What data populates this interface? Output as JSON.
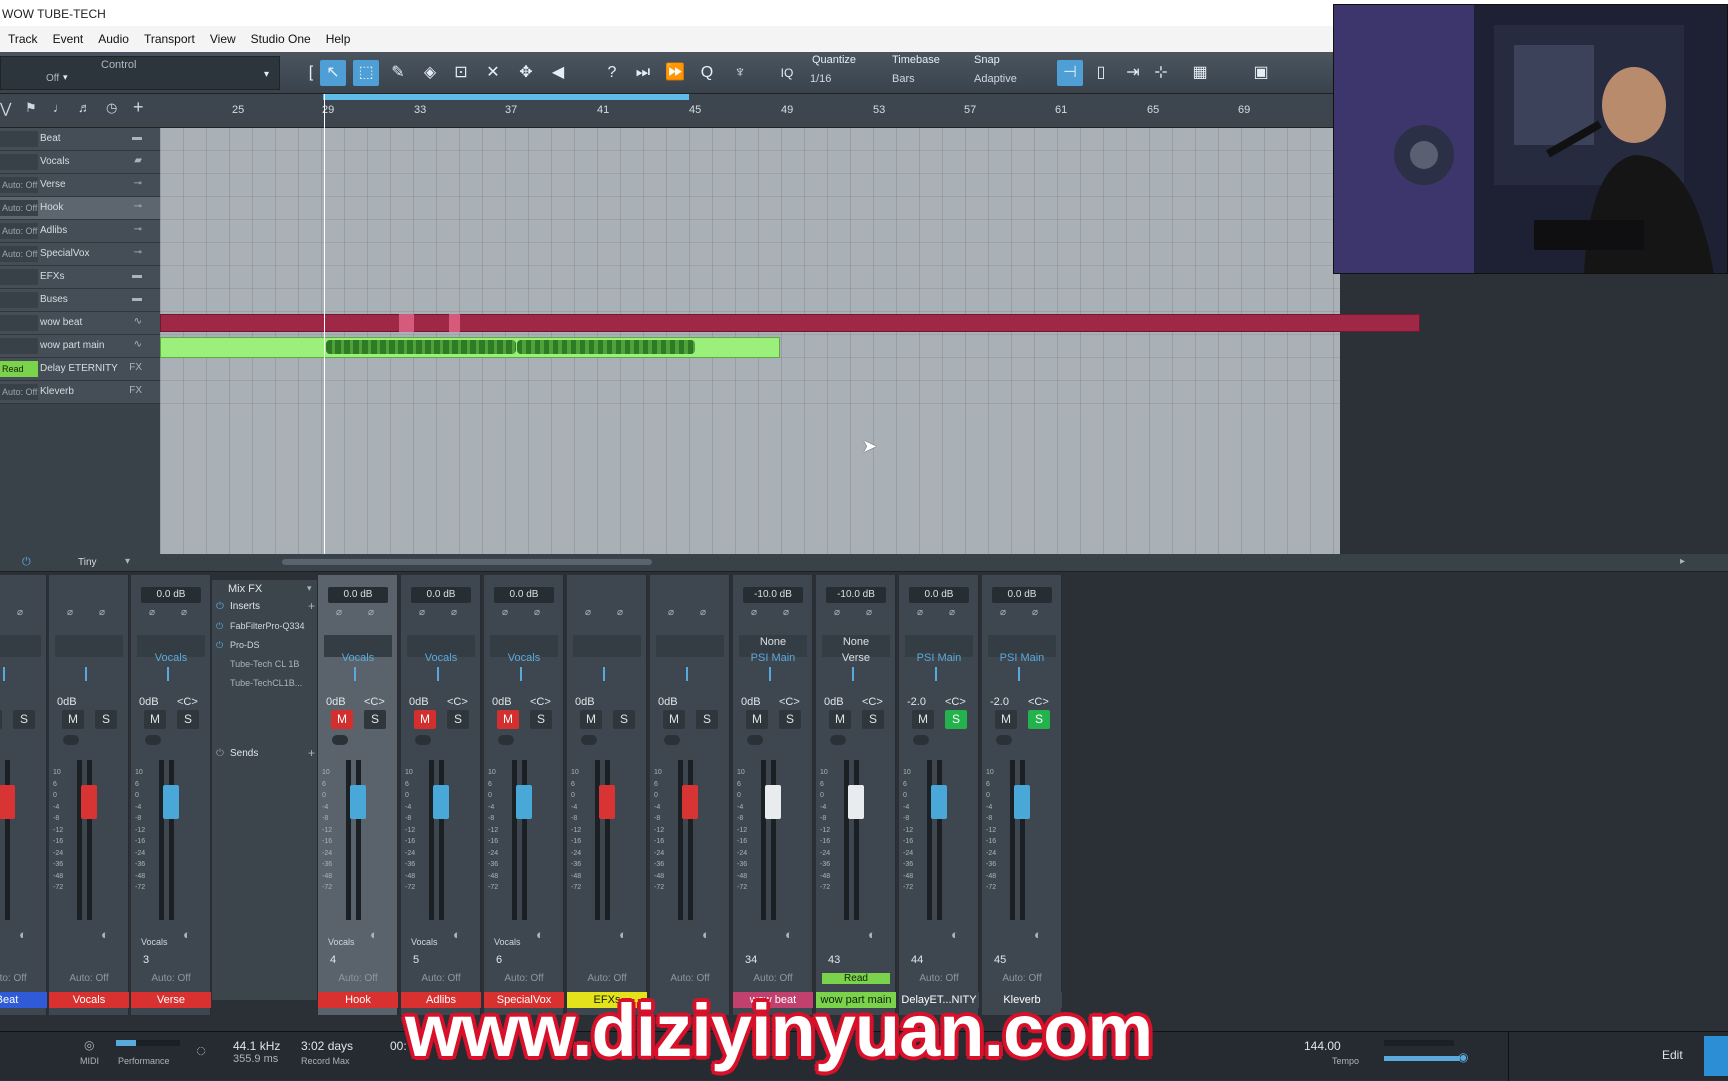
{
  "window": {
    "title": "WOW TUBE-TECH"
  },
  "menu": [
    "Track",
    "Event",
    "Audio",
    "Transport",
    "View",
    "Studio One",
    "Help"
  ],
  "toolbar": {
    "control_label": "Control",
    "control_value": "Off",
    "quantize_label": "Quantize",
    "quantize_value": "1/16",
    "timebase_label": "Timebase",
    "timebase_value": "Bars",
    "snap_label": "Snap",
    "snap_value": "Adaptive",
    "iq_label": "IQ",
    "help_glyph": "?"
  },
  "ruler": {
    "bars": [
      "25",
      "29",
      "33",
      "37",
      "41",
      "45",
      "49",
      "53",
      "57",
      "61",
      "65",
      "69"
    ]
  },
  "tracks": [
    {
      "auto": "",
      "name": "Beat",
      "icon": "folder"
    },
    {
      "auto": "",
      "name": "Vocals",
      "icon": "folder-open"
    },
    {
      "auto": "Auto: Off",
      "name": "Verse",
      "icon": "bus"
    },
    {
      "auto": "Auto: Off",
      "name": "Hook",
      "icon": "bus"
    },
    {
      "auto": "Auto: Off",
      "name": "Adlibs",
      "icon": "bus"
    },
    {
      "auto": "Auto: Off",
      "name": "SpecialVox",
      "icon": "bus"
    },
    {
      "auto": "",
      "name": "EFXs",
      "icon": "folder"
    },
    {
      "auto": "",
      "name": "Buses",
      "icon": "folder"
    },
    {
      "auto": "",
      "name": "wow beat",
      "icon": "wave"
    },
    {
      "auto": "",
      "name": "wow part main",
      "icon": "wave"
    },
    {
      "auto": "Read",
      "name": "Delay ETERNITY",
      "icon": "FX"
    },
    {
      "auto": "Auto: Off",
      "name": "Kleverb",
      "icon": "FX"
    }
  ],
  "arrange": {
    "zoom_label": "Tiny"
  },
  "mixer": {
    "mixfx": {
      "title": "Mix FX",
      "inserts_label": "Inserts",
      "inserts": [
        "FabFilterPro-Q334",
        "Pro-DS",
        "Tube-Tech CL 1B",
        "Tube-TechCL1B..."
      ],
      "sends_label": "Sends"
    },
    "strips": [
      {
        "db": "",
        "route1": "",
        "route2": "",
        "vol": "",
        "pan": "",
        "mute": false,
        "solo": false,
        "num": "",
        "auto": "Auto: Off",
        "name": "Beat",
        "color": "#2f5bd8",
        "fader": "red",
        "label": "",
        "sel": false
      },
      {
        "db": "",
        "route1": "",
        "route2": "",
        "vol": "0dB",
        "pan": "",
        "mute": false,
        "solo": false,
        "num": "",
        "auto": "Auto: Off",
        "name": "Vocals",
        "color": "#d93030",
        "fader": "red",
        "label": "",
        "sel": false
      },
      {
        "db": "0.0 dB",
        "route1": "",
        "route2": "Vocals",
        "vol": "0dB",
        "pan": "<C>",
        "mute": false,
        "solo": false,
        "num": "3",
        "auto": "Auto: Off",
        "name": "Verse",
        "color": "#d93030",
        "fader": "blue",
        "label": "Vocals",
        "sel": false
      },
      {
        "db": "0.0 dB",
        "route1": "",
        "route2": "Vocals",
        "vol": "0dB",
        "pan": "<C>",
        "mute": true,
        "solo": false,
        "num": "4",
        "auto": "Auto: Off",
        "name": "Hook",
        "color": "#d93030",
        "fader": "blue",
        "label": "Vocals",
        "sel": true
      },
      {
        "db": "0.0 dB",
        "route1": "",
        "route2": "Vocals",
        "vol": "0dB",
        "pan": "<C>",
        "mute": true,
        "solo": false,
        "num": "5",
        "auto": "Auto: Off",
        "name": "Adlibs",
        "color": "#d93030",
        "fader": "blue",
        "label": "Vocals",
        "sel": false
      },
      {
        "db": "0.0 dB",
        "route1": "",
        "route2": "Vocals",
        "vol": "0dB",
        "pan": "<C>",
        "mute": true,
        "solo": false,
        "num": "6",
        "auto": "Auto: Off",
        "name": "SpecialVox",
        "color": "#d93030",
        "fader": "blue",
        "label": "Vocals",
        "sel": false
      },
      {
        "db": "",
        "route1": "",
        "route2": "",
        "vol": "0dB",
        "pan": "",
        "mute": false,
        "solo": false,
        "num": "",
        "auto": "Auto: Off",
        "name": "EFXs",
        "color": "#e3e21b",
        "fader": "red",
        "label": "",
        "sel": false
      },
      {
        "db": "",
        "route1": "",
        "route2": "",
        "vol": "0dB",
        "pan": "",
        "mute": false,
        "solo": false,
        "num": "",
        "auto": "Auto: Off",
        "name": "",
        "color": "#c2406e",
        "fader": "red",
        "label": "",
        "sel": false
      },
      {
        "db": "-10.0 dB",
        "route1": "None",
        "route2": "PSI Main",
        "vol": "0dB",
        "pan": "<C>",
        "mute": false,
        "solo": false,
        "num": "34",
        "auto": "Auto: Off",
        "name": "wow beat",
        "color": "#c2406e",
        "fader": "white",
        "label": "",
        "sel": false
      },
      {
        "db": "-10.0 dB",
        "route1": "None",
        "route2": "Verse",
        "vol": "0dB",
        "pan": "<C>",
        "mute": false,
        "solo": false,
        "num": "43",
        "auto": "Read",
        "name": "wow part main",
        "color": "#7bd24b",
        "fader": "white",
        "label": "",
        "sel": false
      },
      {
        "db": "0.0 dB",
        "route1": "",
        "route2": "PSI Main",
        "vol": "-2.0",
        "pan": "<C>",
        "mute": false,
        "solo": true,
        "num": "44",
        "auto": "Auto: Off",
        "name": "DelayET...NITY",
        "color": "#3e474f",
        "fader": "blue",
        "label": "",
        "sel": false
      },
      {
        "db": "0.0 dB",
        "route1": "",
        "route2": "PSI Main",
        "vol": "-2.0",
        "pan": "<C>",
        "mute": false,
        "solo": true,
        "num": "45",
        "auto": "Auto: Off",
        "name": "Kleverb",
        "color": "#3e474f",
        "fader": "blue",
        "label": "",
        "sel": false
      }
    ],
    "scale": [
      "10",
      "6",
      "0",
      "-4",
      "-8",
      "-12",
      "-16",
      "-24",
      "-36",
      "-48",
      "-72"
    ]
  },
  "status": {
    "midi_label": "MIDI",
    "performance_label": "Performance",
    "sample_rate": "44.1 kHz",
    "latency": "355.9 ms",
    "record_days": "3:02 days",
    "record_max_label": "Record Max",
    "time_partial": "00:",
    "tempo_value": "144.00",
    "tempo_label": "Tempo",
    "edit_label": "Edit"
  },
  "overlay": {
    "watermark": "www.diziyinyuan.com"
  }
}
